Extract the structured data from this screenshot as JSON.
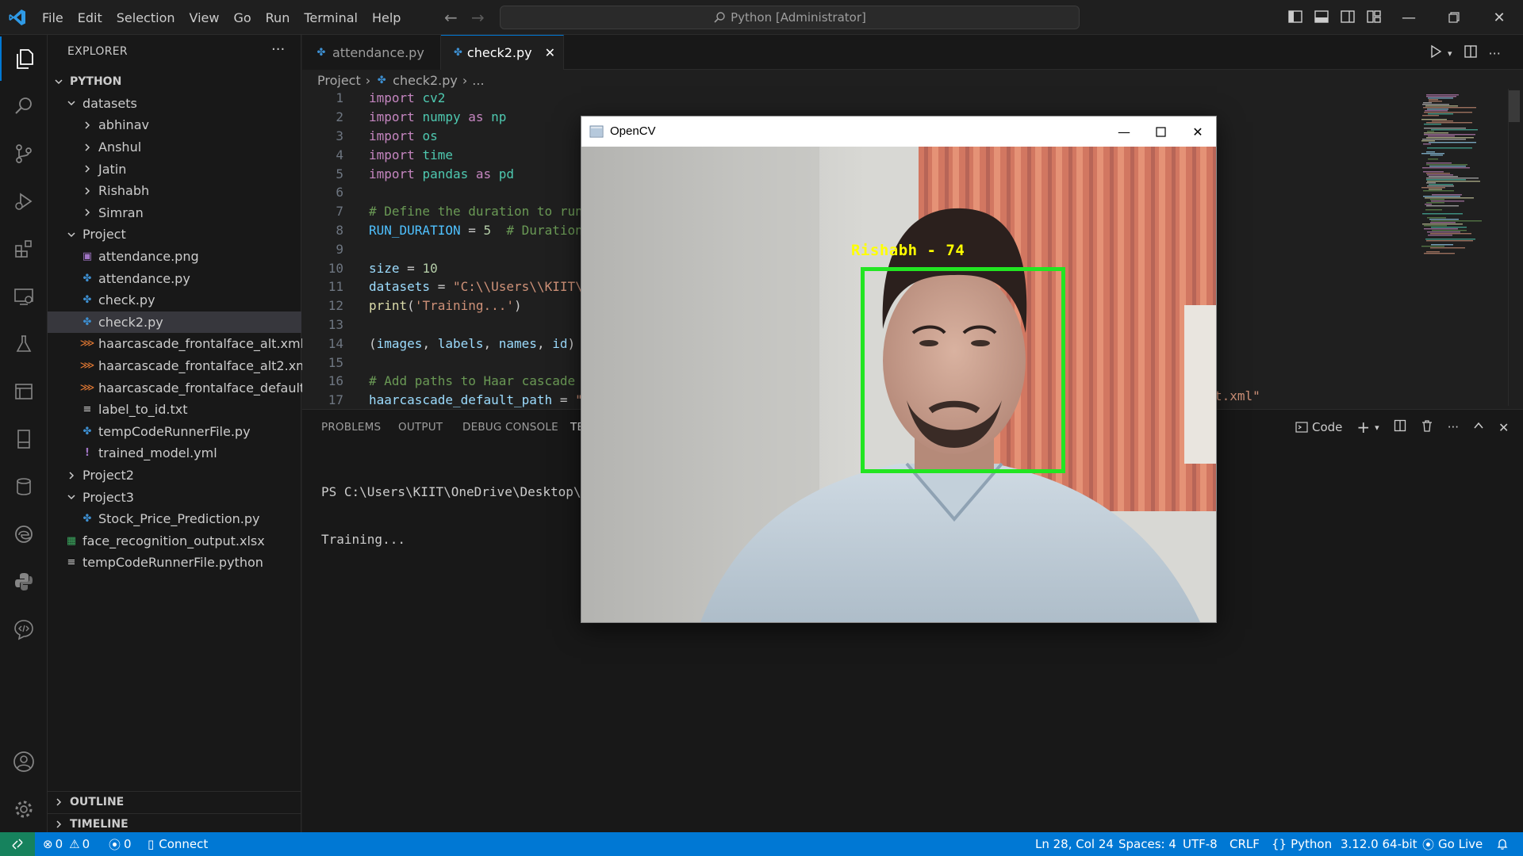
{
  "titlebar": {
    "menu": [
      "File",
      "Edit",
      "Selection",
      "View",
      "Go",
      "Run",
      "Terminal",
      "Help"
    ],
    "command_center": "Python [Administrator]"
  },
  "sidebar": {
    "title": "EXPLORER",
    "root": "PYTHON",
    "tree": [
      {
        "label": "datasets",
        "depth": 1,
        "kind": "folder-open"
      },
      {
        "label": "abhinav",
        "depth": 2,
        "kind": "folder"
      },
      {
        "label": "Anshul",
        "depth": 2,
        "kind": "folder"
      },
      {
        "label": "Jatin",
        "depth": 2,
        "kind": "folder"
      },
      {
        "label": "Rishabh",
        "depth": 2,
        "kind": "folder"
      },
      {
        "label": "Simran",
        "depth": 2,
        "kind": "folder"
      },
      {
        "label": "Project",
        "depth": 1,
        "kind": "folder-open"
      },
      {
        "label": "attendance.png",
        "depth": 2,
        "kind": "image"
      },
      {
        "label": "attendance.py",
        "depth": 2,
        "kind": "python"
      },
      {
        "label": "check.py",
        "depth": 2,
        "kind": "python"
      },
      {
        "label": "check2.py",
        "depth": 2,
        "kind": "python",
        "selected": true
      },
      {
        "label": "haarcascade_frontalface_alt.xml",
        "depth": 2,
        "kind": "xml"
      },
      {
        "label": "haarcascade_frontalface_alt2.xml",
        "depth": 2,
        "kind": "xml"
      },
      {
        "label": "haarcascade_frontalface_default.xml",
        "depth": 2,
        "kind": "xml"
      },
      {
        "label": "label_to_id.txt",
        "depth": 2,
        "kind": "text"
      },
      {
        "label": "tempCodeRunnerFile.py",
        "depth": 2,
        "kind": "python"
      },
      {
        "label": "trained_model.yml",
        "depth": 2,
        "kind": "yml"
      },
      {
        "label": "Project2",
        "depth": 1,
        "kind": "folder"
      },
      {
        "label": "Project3",
        "depth": 1,
        "kind": "folder-open"
      },
      {
        "label": "Stock_Price_Prediction.py",
        "depth": 2,
        "kind": "python"
      },
      {
        "label": "face_recognition_output.xlsx",
        "depth": 1,
        "kind": "excel"
      },
      {
        "label": "tempCodeRunnerFile.python",
        "depth": 1,
        "kind": "text"
      }
    ],
    "outline": "OUTLINE",
    "timeline": "TIMELINE"
  },
  "tabs": [
    {
      "label": "attendance.py",
      "active": false
    },
    {
      "label": "check2.py",
      "active": true
    }
  ],
  "breadcrumb": {
    "folder": "Project",
    "file": "check2.py",
    "more": "..."
  },
  "code_lines": [
    {
      "n": "1",
      "parts": [
        [
          "kw",
          "import"
        ],
        [
          "plain",
          " "
        ],
        [
          "mod",
          "cv2"
        ]
      ]
    },
    {
      "n": "2",
      "parts": [
        [
          "kw",
          "import"
        ],
        [
          "plain",
          " "
        ],
        [
          "mod",
          "numpy"
        ],
        [
          "plain",
          " "
        ],
        [
          "kw",
          "as"
        ],
        [
          "plain",
          " "
        ],
        [
          "mod",
          "np"
        ]
      ]
    },
    {
      "n": "3",
      "parts": [
        [
          "kw",
          "import"
        ],
        [
          "plain",
          " "
        ],
        [
          "mod",
          "os"
        ]
      ]
    },
    {
      "n": "4",
      "parts": [
        [
          "kw",
          "import"
        ],
        [
          "plain",
          " "
        ],
        [
          "mod",
          "time"
        ]
      ]
    },
    {
      "n": "5",
      "parts": [
        [
          "kw",
          "import"
        ],
        [
          "plain",
          " "
        ],
        [
          "mod",
          "pandas"
        ],
        [
          "plain",
          " "
        ],
        [
          "kw",
          "as"
        ],
        [
          "plain",
          " "
        ],
        [
          "mod",
          "pd"
        ]
      ]
    },
    {
      "n": "6",
      "parts": []
    },
    {
      "n": "7",
      "parts": [
        [
          "cmt",
          "# Define the duration to run"
        ]
      ]
    },
    {
      "n": "8",
      "parts": [
        [
          "const",
          "RUN_DURATION"
        ],
        [
          "plain",
          " = "
        ],
        [
          "num",
          "5"
        ],
        [
          "plain",
          "  "
        ],
        [
          "cmt",
          "# Duration"
        ]
      ]
    },
    {
      "n": "9",
      "parts": []
    },
    {
      "n": "10",
      "parts": [
        [
          "var",
          "size"
        ],
        [
          "plain",
          " = "
        ],
        [
          "num",
          "10"
        ]
      ]
    },
    {
      "n": "11",
      "parts": [
        [
          "var",
          "datasets"
        ],
        [
          "plain",
          " = "
        ],
        [
          "str",
          "\"C:\\\\Users\\\\KIIT\\"
        ]
      ]
    },
    {
      "n": "12",
      "parts": [
        [
          "fn",
          "print"
        ],
        [
          "plain",
          "("
        ],
        [
          "str",
          "'Training...'"
        ],
        [
          "plain",
          ")"
        ]
      ]
    },
    {
      "n": "13",
      "parts": []
    },
    {
      "n": "14",
      "parts": [
        [
          "plain",
          "("
        ],
        [
          "var",
          "images"
        ],
        [
          "plain",
          ", "
        ],
        [
          "var",
          "labels"
        ],
        [
          "plain",
          ", "
        ],
        [
          "var",
          "names"
        ],
        [
          "plain",
          ", "
        ],
        [
          "var",
          "id"
        ],
        [
          "plain",
          ")"
        ]
      ]
    },
    {
      "n": "15",
      "parts": []
    },
    {
      "n": "16",
      "parts": [
        [
          "cmt",
          "# Add paths to Haar cascade"
        ]
      ]
    },
    {
      "n": "17",
      "parts": [
        [
          "var",
          "haarcascade_default_path"
        ],
        [
          "plain",
          " = "
        ],
        [
          "str",
          "\""
        ]
      ]
    }
  ],
  "code_tail": "t.xml\"",
  "panel": {
    "tabs": [
      "PROBLEMS",
      "OUTPUT",
      "DEBUG CONSOLE",
      "TE"
    ],
    "terminal_profile": "Code",
    "terminal_lines": [
      "PS C:\\Users\\KIIT\\OneDrive\\Desktop\\Py",
      "Training..."
    ]
  },
  "statusbar": {
    "errors": "0",
    "warnings": "0",
    "ports": "0",
    "connect": "Connect",
    "position": "Ln 28, Col 24",
    "spaces": "Spaces: 4",
    "encoding": "UTF-8",
    "eol": "CRLF",
    "language": "Python",
    "interpreter": "3.12.0 64-bit",
    "golive": "Go Live"
  },
  "opencv": {
    "title": "OpenCV",
    "face_label": "Rishabh - 74"
  },
  "colors": {
    "accent": "#0078d4",
    "statusbar": "#0078d4",
    "remote": "#16825d",
    "face_box": "#22e522",
    "face_label": "#ffff00"
  }
}
